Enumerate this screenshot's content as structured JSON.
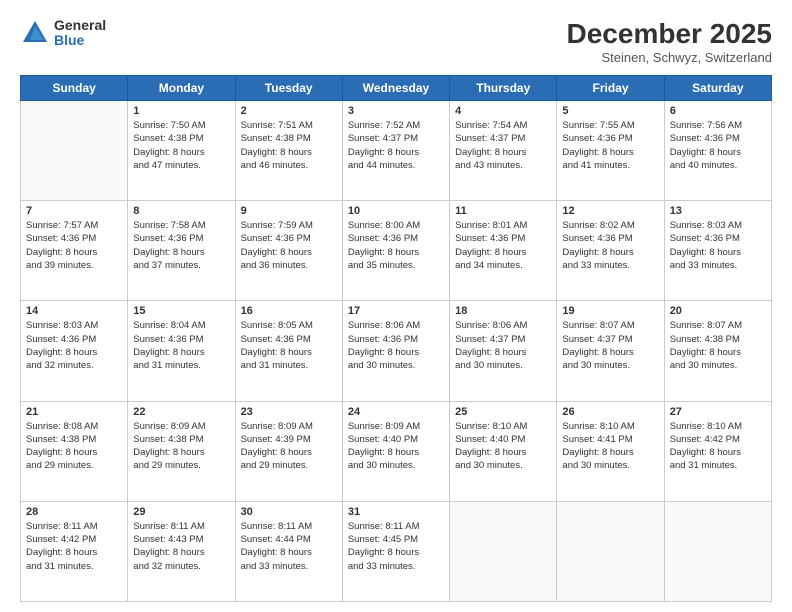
{
  "logo": {
    "general": "General",
    "blue": "Blue"
  },
  "title": "December 2025",
  "location": "Steinen, Schwyz, Switzerland",
  "days_header": [
    "Sunday",
    "Monday",
    "Tuesday",
    "Wednesday",
    "Thursday",
    "Friday",
    "Saturday"
  ],
  "weeks": [
    [
      {
        "day": "",
        "info": ""
      },
      {
        "day": "1",
        "info": "Sunrise: 7:50 AM\nSunset: 4:38 PM\nDaylight: 8 hours\nand 47 minutes."
      },
      {
        "day": "2",
        "info": "Sunrise: 7:51 AM\nSunset: 4:38 PM\nDaylight: 8 hours\nand 46 minutes."
      },
      {
        "day": "3",
        "info": "Sunrise: 7:52 AM\nSunset: 4:37 PM\nDaylight: 8 hours\nand 44 minutes."
      },
      {
        "day": "4",
        "info": "Sunrise: 7:54 AM\nSunset: 4:37 PM\nDaylight: 8 hours\nand 43 minutes."
      },
      {
        "day": "5",
        "info": "Sunrise: 7:55 AM\nSunset: 4:36 PM\nDaylight: 8 hours\nand 41 minutes."
      },
      {
        "day": "6",
        "info": "Sunrise: 7:56 AM\nSunset: 4:36 PM\nDaylight: 8 hours\nand 40 minutes."
      }
    ],
    [
      {
        "day": "7",
        "info": "Sunrise: 7:57 AM\nSunset: 4:36 PM\nDaylight: 8 hours\nand 39 minutes."
      },
      {
        "day": "8",
        "info": "Sunrise: 7:58 AM\nSunset: 4:36 PM\nDaylight: 8 hours\nand 37 minutes."
      },
      {
        "day": "9",
        "info": "Sunrise: 7:59 AM\nSunset: 4:36 PM\nDaylight: 8 hours\nand 36 minutes."
      },
      {
        "day": "10",
        "info": "Sunrise: 8:00 AM\nSunset: 4:36 PM\nDaylight: 8 hours\nand 35 minutes."
      },
      {
        "day": "11",
        "info": "Sunrise: 8:01 AM\nSunset: 4:36 PM\nDaylight: 8 hours\nand 34 minutes."
      },
      {
        "day": "12",
        "info": "Sunrise: 8:02 AM\nSunset: 4:36 PM\nDaylight: 8 hours\nand 33 minutes."
      },
      {
        "day": "13",
        "info": "Sunrise: 8:03 AM\nSunset: 4:36 PM\nDaylight: 8 hours\nand 33 minutes."
      }
    ],
    [
      {
        "day": "14",
        "info": "Sunrise: 8:03 AM\nSunset: 4:36 PM\nDaylight: 8 hours\nand 32 minutes."
      },
      {
        "day": "15",
        "info": "Sunrise: 8:04 AM\nSunset: 4:36 PM\nDaylight: 8 hours\nand 31 minutes."
      },
      {
        "day": "16",
        "info": "Sunrise: 8:05 AM\nSunset: 4:36 PM\nDaylight: 8 hours\nand 31 minutes."
      },
      {
        "day": "17",
        "info": "Sunrise: 8:06 AM\nSunset: 4:36 PM\nDaylight: 8 hours\nand 30 minutes."
      },
      {
        "day": "18",
        "info": "Sunrise: 8:06 AM\nSunset: 4:37 PM\nDaylight: 8 hours\nand 30 minutes."
      },
      {
        "day": "19",
        "info": "Sunrise: 8:07 AM\nSunset: 4:37 PM\nDaylight: 8 hours\nand 30 minutes."
      },
      {
        "day": "20",
        "info": "Sunrise: 8:07 AM\nSunset: 4:38 PM\nDaylight: 8 hours\nand 30 minutes."
      }
    ],
    [
      {
        "day": "21",
        "info": "Sunrise: 8:08 AM\nSunset: 4:38 PM\nDaylight: 8 hours\nand 29 minutes."
      },
      {
        "day": "22",
        "info": "Sunrise: 8:09 AM\nSunset: 4:38 PM\nDaylight: 8 hours\nand 29 minutes."
      },
      {
        "day": "23",
        "info": "Sunrise: 8:09 AM\nSunset: 4:39 PM\nDaylight: 8 hours\nand 29 minutes."
      },
      {
        "day": "24",
        "info": "Sunrise: 8:09 AM\nSunset: 4:40 PM\nDaylight: 8 hours\nand 30 minutes."
      },
      {
        "day": "25",
        "info": "Sunrise: 8:10 AM\nSunset: 4:40 PM\nDaylight: 8 hours\nand 30 minutes."
      },
      {
        "day": "26",
        "info": "Sunrise: 8:10 AM\nSunset: 4:41 PM\nDaylight: 8 hours\nand 30 minutes."
      },
      {
        "day": "27",
        "info": "Sunrise: 8:10 AM\nSunset: 4:42 PM\nDaylight: 8 hours\nand 31 minutes."
      }
    ],
    [
      {
        "day": "28",
        "info": "Sunrise: 8:11 AM\nSunset: 4:42 PM\nDaylight: 8 hours\nand 31 minutes."
      },
      {
        "day": "29",
        "info": "Sunrise: 8:11 AM\nSunset: 4:43 PM\nDaylight: 8 hours\nand 32 minutes."
      },
      {
        "day": "30",
        "info": "Sunrise: 8:11 AM\nSunset: 4:44 PM\nDaylight: 8 hours\nand 33 minutes."
      },
      {
        "day": "31",
        "info": "Sunrise: 8:11 AM\nSunset: 4:45 PM\nDaylight: 8 hours\nand 33 minutes."
      },
      {
        "day": "",
        "info": ""
      },
      {
        "day": "",
        "info": ""
      },
      {
        "day": "",
        "info": ""
      }
    ]
  ]
}
